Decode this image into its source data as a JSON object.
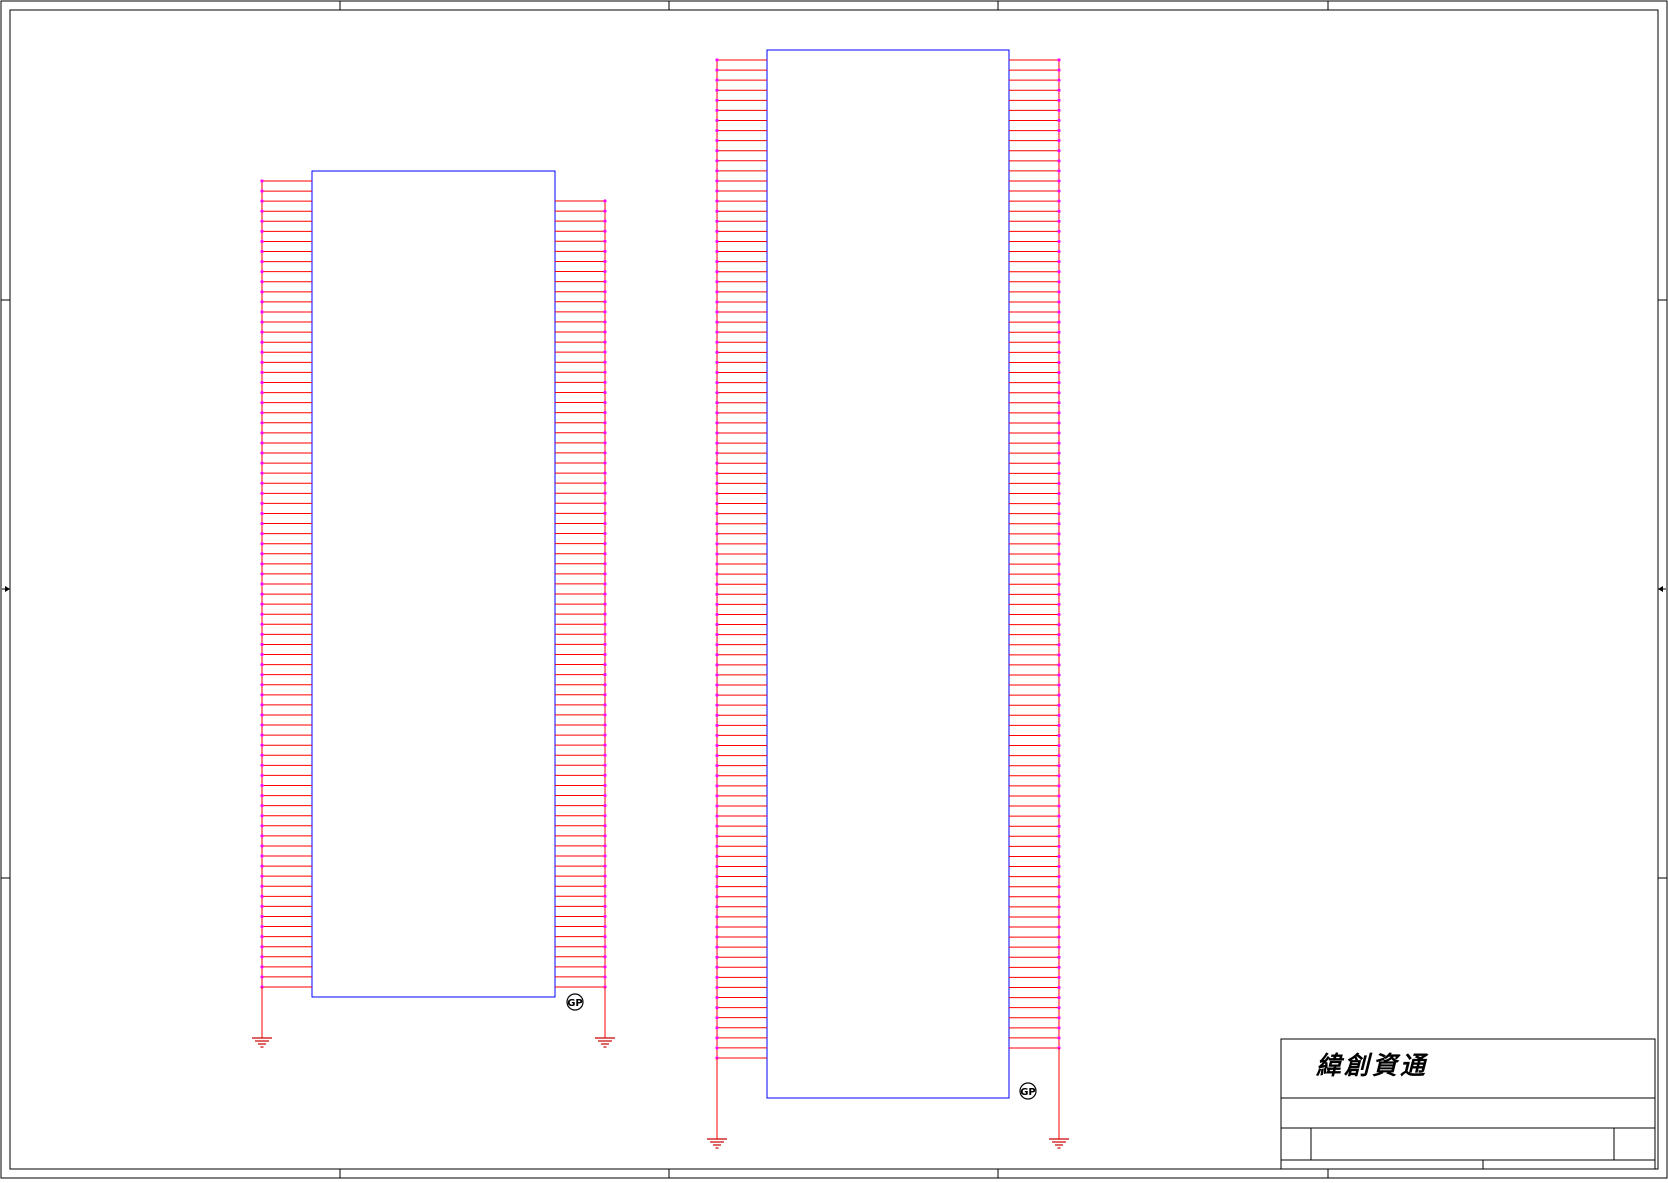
{
  "title_block": {
    "company": "緯創資通"
  },
  "logo_text": "GP",
  "connector_1": {
    "left_pin_count": 81,
    "right_pin_count": 79
  },
  "connector_2": {
    "left_pin_count": 100,
    "right_pin_count": 99
  },
  "colors": {
    "border": "#000000",
    "body": "#0000ff",
    "pin": "#ff0000",
    "pin_end": "#ff00ff",
    "ground": "#cc0000"
  }
}
